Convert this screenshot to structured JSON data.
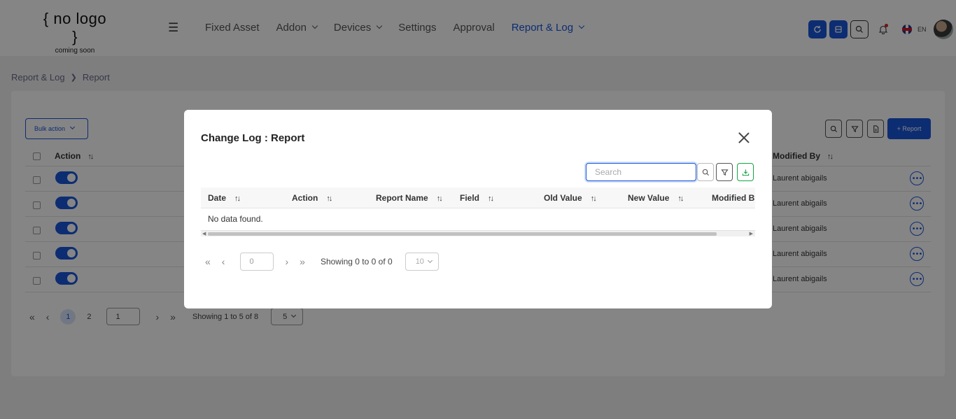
{
  "header": {
    "logo_main": "{ no logo }",
    "logo_sub": "coming soon",
    "nav": [
      {
        "label": "Fixed Asset"
      },
      {
        "label": "Addon"
      },
      {
        "label": "Devices"
      },
      {
        "label": "Settings"
      },
      {
        "label": "Approval"
      },
      {
        "label": "Report & Log"
      }
    ],
    "lang": "EN"
  },
  "breadcrumb": {
    "parent": "Report & Log",
    "current": "Report"
  },
  "toolbar": {
    "bulk_action": "Bulk action",
    "add_report": "+ Report"
  },
  "background_table": {
    "columns": {
      "action": "Action",
      "modified_by": "Modified By"
    },
    "rows": [
      {
        "modified_by": "Laurent abigails"
      },
      {
        "modified_by": "Laurent abigails"
      },
      {
        "modified_by": "Laurent abigails"
      },
      {
        "modified_by": "Laurent abigails"
      },
      {
        "modified_by": "Laurent abigails"
      }
    ],
    "pager": {
      "page1": "1",
      "page2": "2",
      "current": "1",
      "showing": "Showing 1 to 5 of 8",
      "per_page": "5"
    }
  },
  "modal": {
    "title": "Change Log : Report",
    "search_placeholder": "Search",
    "columns": [
      "Date",
      "Action",
      "Report Name",
      "Field",
      "Old Value",
      "New Value",
      "Modified By"
    ],
    "empty": "No data found.",
    "pager": {
      "current": "0",
      "showing": "Showing 0 to 0 of 0",
      "per_page": "10"
    }
  },
  "colors": {
    "accent": "#1a56db",
    "download": "#16a34a"
  }
}
